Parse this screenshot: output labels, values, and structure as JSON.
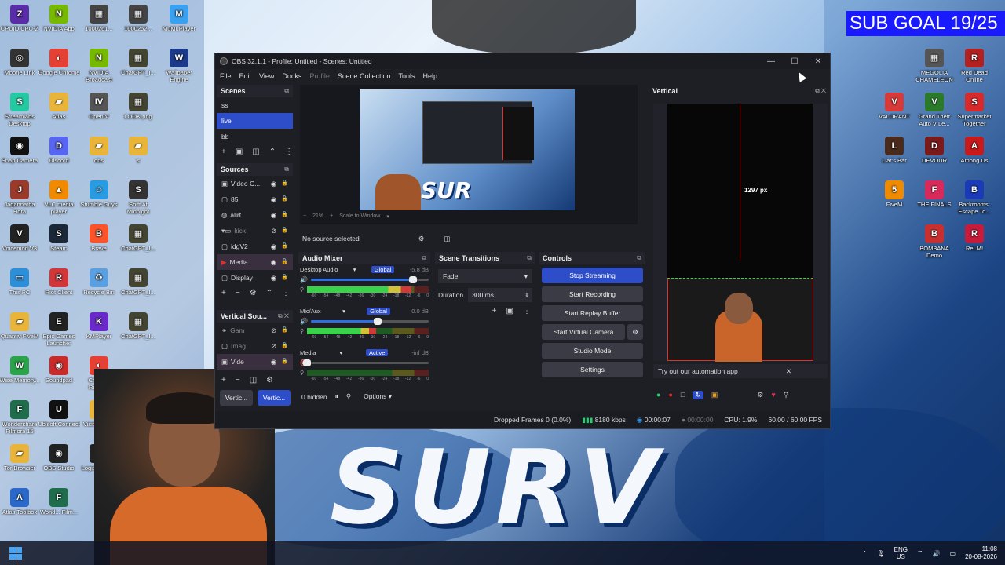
{
  "overlay": {
    "sub_goal": "SUB GOAL 19/25"
  },
  "desktop": {
    "col1": [
      {
        "label": "CPUID CPU-Z",
        "icon": "cpuz-icon",
        "color": "#5a2da8",
        "glyph": "Z"
      },
      {
        "label": "Mbone Link",
        "icon": "link-icon",
        "color": "#333",
        "glyph": "◎"
      },
      {
        "label": "Streamlabs Desktop",
        "icon": "streamlabs-icon",
        "color": "#23c9a0",
        "glyph": "S"
      },
      {
        "label": "Snap Camera",
        "icon": "snapcamera-icon",
        "color": "#111",
        "glyph": "◉"
      },
      {
        "label": "Jagannatha Hora",
        "icon": "app-icon",
        "color": "#9b3a2a",
        "glyph": "J"
      },
      {
        "label": "Voicemod V3",
        "icon": "voicemod-icon",
        "color": "#222",
        "glyph": "V"
      },
      {
        "label": "This PC",
        "icon": "pc-icon",
        "color": "#2c8fd8",
        "glyph": "▭"
      },
      {
        "label": "Quantiv FiveM",
        "icon": "folder-icon",
        "color": "#e8b43a",
        "glyph": "▰"
      },
      {
        "label": "Wise Memory...",
        "icon": "wise-icon",
        "color": "#2aa34a",
        "glyph": "W"
      },
      {
        "label": "Wondershare Filmora 15",
        "icon": "filmora-icon",
        "color": "#1f6d4b",
        "glyph": "F"
      },
      {
        "label": "Tor Browser",
        "icon": "folder-icon",
        "color": "#e8b43a",
        "glyph": "▰"
      },
      {
        "label": "Atlas Toolbox",
        "icon": "atlas-icon",
        "color": "#2a69c9",
        "glyph": "A"
      }
    ],
    "col2": [
      {
        "label": "NVIDIA App",
        "icon": "nvidia-icon",
        "color": "#76b900",
        "glyph": "N"
      },
      {
        "label": "Google Chrome",
        "icon": "chrome-icon",
        "color": "#e44134",
        "glyph": "◐"
      },
      {
        "label": "Atlas",
        "icon": "folder-icon",
        "color": "#e8b43a",
        "glyph": "▰"
      },
      {
        "label": "Discord",
        "icon": "discord-icon",
        "color": "#5865f2",
        "glyph": "D"
      },
      {
        "label": "VLC media player",
        "icon": "vlc-icon",
        "color": "#f08a00",
        "glyph": "▲"
      },
      {
        "label": "Steam",
        "icon": "steam-icon",
        "color": "#1b2838",
        "glyph": "S"
      },
      {
        "label": "Riot Client",
        "icon": "riot-icon",
        "color": "#d13639",
        "glyph": "R"
      },
      {
        "label": "Epic Games Launcher",
        "icon": "epic-icon",
        "color": "#222",
        "glyph": "E"
      },
      {
        "label": "Soundpad",
        "icon": "soundpad-icon",
        "color": "#c92a2a",
        "glyph": "◉"
      },
      {
        "label": "Ubisoft Connect",
        "icon": "ubisoft-icon",
        "color": "#111",
        "glyph": "U"
      },
      {
        "label": "OBS Studio",
        "icon": "obs-icon",
        "color": "#222",
        "glyph": "◉"
      },
      {
        "label": "Wond... Film...",
        "icon": "filmora-icon",
        "color": "#1f6d4b",
        "glyph": "F"
      }
    ],
    "col3": [
      {
        "label": "1000261...",
        "icon": "image-icon",
        "color": "#444",
        "glyph": "▦"
      },
      {
        "label": "NVIDIA Broadcast",
        "icon": "nvidia-icon",
        "color": "#76b900",
        "glyph": "N"
      },
      {
        "label": "OpenIV",
        "icon": "openiv-icon",
        "color": "#555",
        "glyph": "IV"
      },
      {
        "label": "obs",
        "icon": "folder-icon",
        "color": "#e8b43a",
        "glyph": "▰"
      },
      {
        "label": "Stumble Guys",
        "icon": "stumble-icon",
        "color": "#2a9be0",
        "glyph": "☺"
      },
      {
        "label": "Brave",
        "icon": "brave-icon",
        "color": "#fb542b",
        "glyph": "B"
      },
      {
        "label": "Recycle Bin",
        "icon": "recycle-bin-icon",
        "color": "#5aa0e0",
        "glyph": "♻"
      },
      {
        "label": "KMPlayer",
        "icon": "kmplayer-icon",
        "color": "#6a2ac9",
        "glyph": "K"
      },
      {
        "label": "Chrome Remo...",
        "icon": "chrome-icon",
        "color": "#e44134",
        "glyph": "◐"
      },
      {
        "label": "Visit Rede...",
        "icon": "gift-icon",
        "color": "#e8b43a",
        "glyph": "♦"
      },
      {
        "label": "Logite... HUB",
        "icon": "logitech-icon",
        "color": "#222",
        "glyph": "G"
      }
    ],
    "col4": [
      {
        "label": "1000252...",
        "icon": "image-icon",
        "color": "#444",
        "glyph": "▦"
      },
      {
        "label": "ChatGPT_I...",
        "icon": "image-icon",
        "color": "#443",
        "glyph": "▦"
      },
      {
        "label": "LOOK.png",
        "icon": "image-icon",
        "color": "#443",
        "glyph": "▦"
      },
      {
        "label": "s",
        "icon": "folder-icon",
        "color": "#e8b43a",
        "glyph": "▰"
      },
      {
        "label": "Shift At Midnight",
        "icon": "game-icon",
        "color": "#333",
        "glyph": "S"
      },
      {
        "label": "ChatGPT_I...",
        "icon": "image-icon",
        "color": "#443",
        "glyph": "▦"
      },
      {
        "label": "ChatGPT_I...",
        "icon": "image-icon",
        "color": "#443",
        "glyph": "▦"
      },
      {
        "label": "ChatGPT_I...",
        "icon": "image-icon",
        "color": "#443",
        "glyph": "▦"
      }
    ],
    "col5": [
      {
        "label": "MuMuPlayer",
        "icon": "mumu-icon",
        "color": "#3aa0f0",
        "glyph": "M"
      },
      {
        "label": "Wallpaper Engine",
        "icon": "wallpaper-engine-icon",
        "color": "#1b3a8a",
        "glyph": "W"
      }
    ],
    "right_col1": [
      {
        "label": "MEGOLIA CHAMELEON",
        "icon": "image-icon",
        "color": "#555",
        "glyph": "▦"
      },
      {
        "label": "Grand Theft Auto V Le...",
        "icon": "gta-icon",
        "color": "#2a7a2a",
        "glyph": "V"
      },
      {
        "label": "DEVOUR",
        "icon": "devour-icon",
        "color": "#7a1a1a",
        "glyph": "D"
      },
      {
        "label": "THE FINALS",
        "icon": "finals-icon",
        "color": "#d82a5a",
        "glyph": "F"
      },
      {
        "label": "BOMBANA Demo",
        "icon": "bombana-icon",
        "color": "#c83030",
        "glyph": "B"
      }
    ],
    "right_col2": [
      {
        "label": "VALORANT",
        "icon": "valorant-icon",
        "color": "#d83a3a",
        "glyph": "V"
      },
      {
        "label": "Liar's Bar",
        "icon": "game-icon",
        "color": "#4a2a1a",
        "glyph": "L"
      },
      {
        "label": "FiveM",
        "icon": "fivem-icon",
        "color": "#f08a00",
        "glyph": "5"
      }
    ],
    "right_col3": [
      {
        "label": "Red Dead Online",
        "icon": "rdo-icon",
        "color": "#b32020",
        "glyph": "R"
      },
      {
        "label": "Supermarket Together",
        "icon": "supermarket-icon",
        "color": "#d82a2a",
        "glyph": "S"
      },
      {
        "label": "Among Us",
        "icon": "amongus-icon",
        "color": "#c81a1a",
        "glyph": "A"
      },
      {
        "label": "Backrooms: Escape To...",
        "icon": "backrooms-icon",
        "color": "#1a3ab8",
        "glyph": "B"
      },
      {
        "label": "ReLM!",
        "icon": "game-icon",
        "color": "#c81a3a",
        "glyph": "R"
      }
    ]
  },
  "obs": {
    "title": "OBS 32.1.1 - Profile: Untitled - Scenes: Untitled",
    "menu": [
      "File",
      "Edit",
      "View",
      "Docks",
      "Profile",
      "Scene Collection",
      "Tools",
      "Help"
    ],
    "scenes": {
      "title": "Scenes",
      "items": [
        "ss",
        "live",
        "bb"
      ],
      "selected": 1
    },
    "sources": {
      "title": "Sources",
      "items": [
        {
          "label": "Video C...",
          "icon": "camera-icon",
          "active": false
        },
        {
          "label": "85",
          "icon": "scene-icon",
          "active": false
        },
        {
          "label": "alirt",
          "icon": "browser-icon",
          "active": false
        },
        {
          "label": "kick",
          "icon": "folder-icon",
          "active": false,
          "dim": true
        },
        {
          "label": "idgV2",
          "icon": "image-icon",
          "active": false
        },
        {
          "label": "Media",
          "icon": "play-icon",
          "active": true
        },
        {
          "label": "Display",
          "icon": "display-icon",
          "active": false
        }
      ]
    },
    "vertical_sources": {
      "title": "Vertical Sou...",
      "items": [
        {
          "label": "Gam",
          "icon": "link-icon",
          "dim": true
        },
        {
          "label": "Imag",
          "icon": "image-icon",
          "dim": true
        },
        {
          "label": "Vide",
          "icon": "camera-icon",
          "active": true
        }
      ],
      "tabs": [
        "Vertic...",
        "Vertic..."
      ]
    },
    "preview": {
      "zoom": "21%",
      "scale": "Scale to Window",
      "no_source": "No source selected"
    },
    "audio_mixer": {
      "title": "Audio Mixer",
      "channels": [
        {
          "name": "Desktop Audio",
          "badge": "Global",
          "db": "-5.8 dB",
          "level": 0.9
        },
        {
          "name": "Mic/Aux",
          "badge": "Global",
          "db": "0.0 dB",
          "level": 0.6
        },
        {
          "name": "Media",
          "badge": "Active",
          "db": "-inf dB",
          "level": 0.0,
          "muted": true
        }
      ],
      "ticks": [
        "-60",
        "-54",
        "-48",
        "-42",
        "-36",
        "-30",
        "-24",
        "-18",
        "-12",
        "-6",
        "0"
      ],
      "hidden": "0 hidden",
      "options": "Options"
    },
    "scene_transitions": {
      "title": "Scene Transitions",
      "type": "Fade",
      "duration_label": "Duration",
      "duration": "300 ms"
    },
    "controls": {
      "title": "Controls",
      "buttons": [
        "Stop Streaming",
        "Start Recording",
        "Start Replay Buffer",
        "Start Virtual Camera",
        "Studio Mode",
        "Settings"
      ]
    },
    "vertical": {
      "title": "Vertical",
      "measure": "1297 px",
      "promo": "Try out our automation app"
    },
    "status": {
      "dropped": "Dropped Frames 0 (0.0%)",
      "kbps": "8180 kbps",
      "stream_time": "00:00:07",
      "rec_time": "00:00:00",
      "cpu": "CPU: 1.9%",
      "fps": "60.00 / 60.00 FPS"
    }
  },
  "taskbar": {
    "lang": "ENG",
    "region": "US",
    "time": "11:08",
    "date": "20-08-2026"
  },
  "colors": {
    "accent": "#2e4ec9",
    "obs_bg": "#1e1f25",
    "live_dot": "#e03030"
  }
}
